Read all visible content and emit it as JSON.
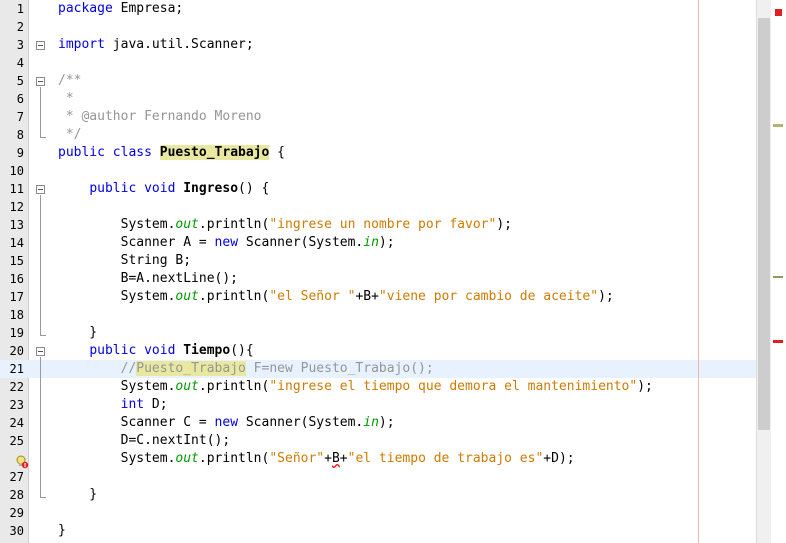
{
  "editor": {
    "lines": [
      {
        "n": "1",
        "html": "<span class=\"kw\">package</span> Empresa;"
      },
      {
        "n": "2",
        "html": ""
      },
      {
        "n": "3",
        "html": "<span class=\"kw\">import</span> java.util.Scanner;"
      },
      {
        "n": "4",
        "html": ""
      },
      {
        "n": "5",
        "html": "<span class=\"cmt\">/**</span>"
      },
      {
        "n": "6",
        "html": "<span class=\"cmt\"> *</span>"
      },
      {
        "n": "7",
        "html": "<span class=\"cmt\"> * @author Fernando Moreno</span>"
      },
      {
        "n": "8",
        "html": "<span class=\"cmt\"> */</span>"
      },
      {
        "n": "9",
        "html": "<span class=\"kw\">public class</span> <span class=\"bold hl\">Puesto_Trabajo</span> {"
      },
      {
        "n": "10",
        "html": ""
      },
      {
        "n": "11",
        "html": "    <span class=\"kw\">public void</span> <span class=\"bold\">Ingreso</span>() {"
      },
      {
        "n": "12",
        "html": ""
      },
      {
        "n": "13",
        "html": "        System.<span class=\"fld\">out</span>.println(<span class=\"str\">\"ingrese un nombre por favor\"</span>);"
      },
      {
        "n": "14",
        "html": "        Scanner A = <span class=\"kw\">new</span> Scanner(System.<span class=\"fld\">in</span>);"
      },
      {
        "n": "15",
        "html": "        String B;"
      },
      {
        "n": "16",
        "html": "        B=A.nextLine();"
      },
      {
        "n": "17",
        "html": "        System.<span class=\"fld\">out</span>.println(<span class=\"str\">\"el Señor \"</span>+B+<span class=\"str\">\"viene por cambio de aceite\"</span>);"
      },
      {
        "n": "18",
        "html": ""
      },
      {
        "n": "19",
        "html": "    }"
      },
      {
        "n": "20",
        "html": "    <span class=\"kw\">public void</span> <span class=\"bold\">Tiempo</span>(){"
      },
      {
        "n": "21",
        "html": "        <span class=\"cmt\">//<span class=\"hl\">Puesto_Trabajo</span> F=new Puesto_Trabajo();</span>"
      },
      {
        "n": "22",
        "html": "        System.<span class=\"fld\">out</span>.println(<span class=\"str\">\"ingrese el tiempo que demora el mantenimiento\"</span>);"
      },
      {
        "n": "23",
        "html": "        <span class=\"kw\">int</span> D;"
      },
      {
        "n": "24",
        "html": "        Scanner C = <span class=\"kw\">new</span> Scanner(System.<span class=\"fld\">in</span>);"
      },
      {
        "n": "25",
        "html": "        D=C.nextInt();"
      },
      {
        "n": "",
        "html": "        System.<span class=\"fld\">out</span>.println(<span class=\"str\">\"Señor\"</span>+<span class=\"err\">B</span>+<span class=\"str\">\"el tiempo de trabajo es\"</span>+D);"
      },
      {
        "n": "27",
        "html": ""
      },
      {
        "n": "28",
        "html": "    }"
      },
      {
        "n": "29",
        "html": ""
      },
      {
        "n": "30",
        "html": "}"
      }
    ],
    "current_line_index": 20,
    "hint_line_index": 25
  },
  "colors": {
    "keyword": "#0000e6",
    "string": "#ce7b00",
    "comment": "#969696",
    "field": "#009900",
    "highlight": "#e8e8a0",
    "error": "#e02020",
    "warning": "#b8b470"
  },
  "icons": {
    "hint": "lightbulb-error-icon",
    "fold": "fold-toggle-icon",
    "status": "error-status-icon"
  }
}
